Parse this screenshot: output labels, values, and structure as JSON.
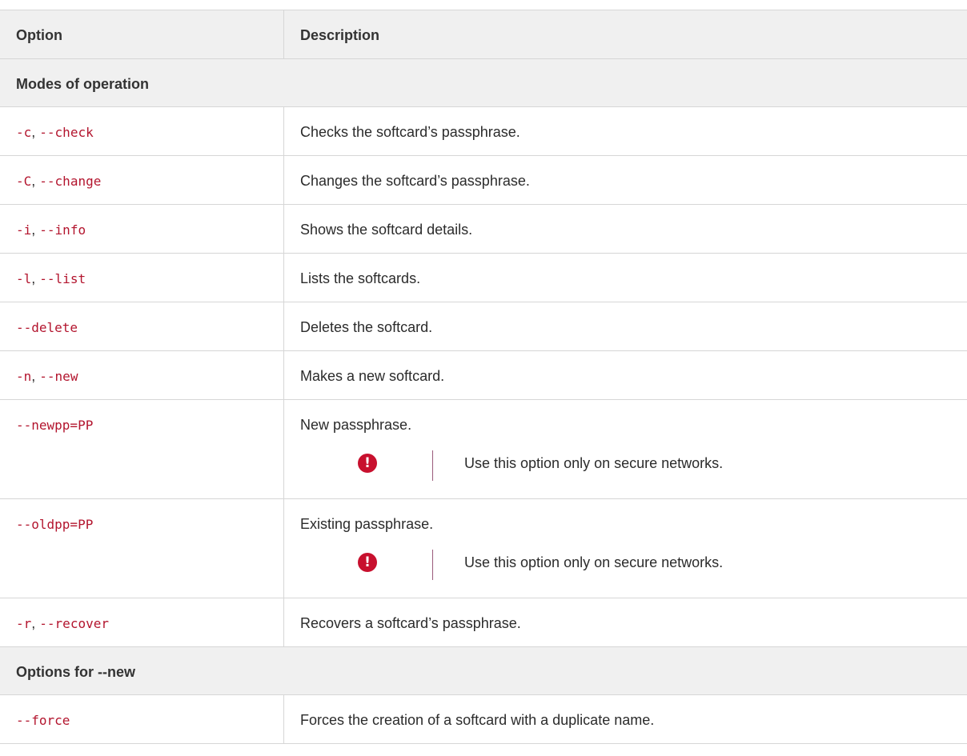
{
  "columns": {
    "option": "Option",
    "description": "Description"
  },
  "sections": [
    {
      "title": "Modes of operation",
      "rows": [
        {
          "flags": [
            "-c",
            "--check"
          ],
          "description": "Checks the softcard’s passphrase."
        },
        {
          "flags": [
            "-C",
            "--change"
          ],
          "description": "Changes the softcard’s passphrase."
        },
        {
          "flags": [
            "-i",
            "--info"
          ],
          "description": "Shows the softcard details."
        },
        {
          "flags": [
            "-l",
            "--list"
          ],
          "description": "Lists the softcards."
        },
        {
          "flags": [
            "--delete"
          ],
          "description": "Deletes the softcard."
        },
        {
          "flags": [
            "-n",
            "--new"
          ],
          "description": "Makes a new softcard."
        },
        {
          "flags": [
            "--newpp=PP"
          ],
          "description": "New passphrase.",
          "warning": "Use this option only on secure networks."
        },
        {
          "flags": [
            "--oldpp=PP"
          ],
          "description": "Existing passphrase.",
          "warning": "Use this option only on secure networks."
        },
        {
          "flags": [
            "-r",
            "--recover"
          ],
          "description": "Recovers a softcard’s passphrase."
        }
      ]
    },
    {
      "title": "Options for --new",
      "rows": [
        {
          "flags": [
            "--force"
          ],
          "description": "Forces the creation of a softcard with a duplicate name."
        }
      ]
    }
  ],
  "flag_separator": ", ",
  "warning_icon": {
    "name": "exclamation-icon",
    "glyph": "!",
    "color": "#c8102e"
  },
  "colors": {
    "code": "#b3152e",
    "header_bg": "#f0f0f0",
    "border": "#d6d6d6"
  }
}
